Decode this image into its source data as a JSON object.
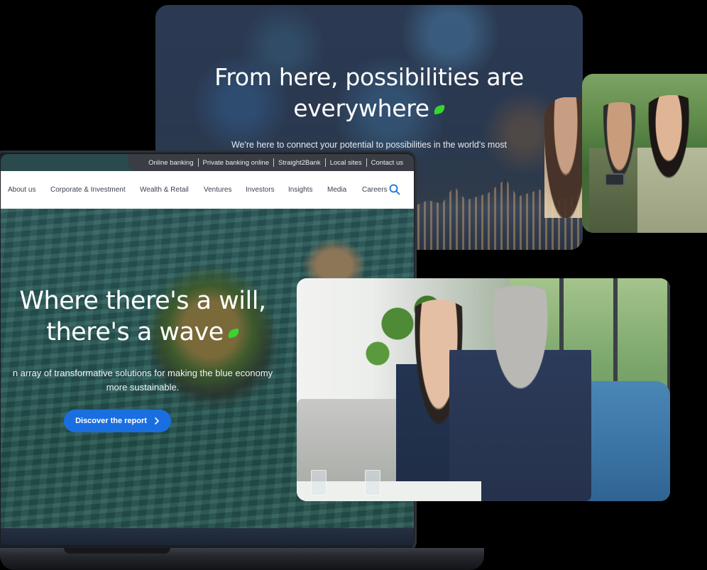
{
  "back_hero": {
    "title_line1": "From here, possibilities are",
    "title_line2": "everywhere",
    "subtitle": "We're here to connect your potential to possibilities in the world's most"
  },
  "utility_nav": {
    "items": [
      "Online banking",
      "Private banking online",
      "Straight2Bank",
      "Local sites",
      "Contact us"
    ]
  },
  "main_nav": {
    "items": [
      "About us",
      "Corporate & Investment",
      "Wealth & Retail",
      "Ventures",
      "Investors",
      "Insights",
      "Media",
      "Careers"
    ]
  },
  "hero": {
    "title_line1": "Where there's a will,",
    "title_line2": "there's a wave",
    "subtitle_line1": "n array of transformative solutions for making the blue economy",
    "subtitle_line2": "more sustainable.",
    "cta_label": "Discover the report",
    "cta_icon": "chevron-right-icon"
  },
  "colors": {
    "accent_blue": "#1a6fe0",
    "accent_green": "#38d430",
    "utility_bar": "#3a3d44"
  },
  "icons": [
    "search-icon",
    "chevron-right-icon",
    "green-leaf-icon"
  ]
}
